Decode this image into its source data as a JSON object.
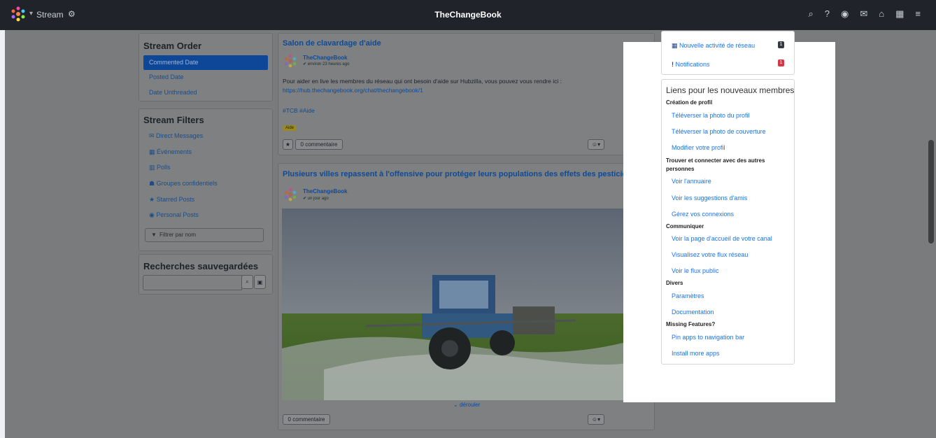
{
  "navbar": {
    "app_label": "Stream",
    "title": "TheChangeBook",
    "icons": [
      "search-icon",
      "help-icon",
      "channels-icon",
      "mail-icon",
      "home-icon",
      "apps-grid-icon",
      "menu-icon"
    ]
  },
  "stream_order": {
    "title": "Stream Order",
    "items": [
      "Commented Date",
      "Posted Date",
      "Date Unthreaded"
    ]
  },
  "stream_filters": {
    "title": "Stream Filters",
    "items": [
      "Direct Messages",
      "Événements",
      "Polls",
      "Groupes confidentiels",
      "Starred Posts",
      "Personal Posts"
    ],
    "filter_placeholder": "Filtrer par nom"
  },
  "saved_searches": {
    "title": "Recherches sauvegardées"
  },
  "post1": {
    "title": "Salon de clavardage d'aide",
    "author": "TheChangeBook",
    "time": "environ 23 heures ago",
    "text": "Pour aider en live les membres du réseau qui ont besoin d'aide sur Hubzilla, vous pouvez vous rendre ici :",
    "link": "https://hub.thechangebook.org/chat/thechangebook/1",
    "hashtags": "#TCB #Aide",
    "tag": "Aide",
    "comment_label": "0 commentaire"
  },
  "post2": {
    "title": "Plusieurs villes repassent à l'offensive pour protéger leurs populations des effets des pesticides",
    "author": "TheChangeBook",
    "time": "un jour ago",
    "expand_label": "dérouler",
    "comment_label": "0 commentaire"
  },
  "right_top": {
    "network_activity": "Nouvelle activité de réseau",
    "network_count": "1",
    "notifications": "Notifications",
    "notifications_count": "1"
  },
  "new_member": {
    "title": "Liens pour les nouveaux membres",
    "sections": [
      {
        "heading": "Création de profil",
        "links": [
          "Téléverser la photo du profil",
          "Téléverser la photo de couverture",
          "Modifier votre profil"
        ]
      },
      {
        "heading": "Trouver et connecter avec des autres personnes",
        "links": [
          "Voir l'annuaire",
          "Voir les suggestions d'amis",
          "Gérez vos connexions"
        ]
      },
      {
        "heading": "Communiquer",
        "links": [
          "Voir la page d'accueil de votre canal",
          "Visualisez votre flux réseau",
          "Voir le flux public"
        ]
      },
      {
        "heading": "Divers",
        "links": [
          "Paramètres",
          "Documentation"
        ]
      },
      {
        "heading": "Missing Features?",
        "links": [
          "Pin apps to navigation bar",
          "Install more apps"
        ]
      }
    ]
  },
  "colors": {
    "navbar": "#20242a",
    "overlay": "#7a7b7d",
    "link": "#1a73e8",
    "badge_red": "#dc3545"
  }
}
